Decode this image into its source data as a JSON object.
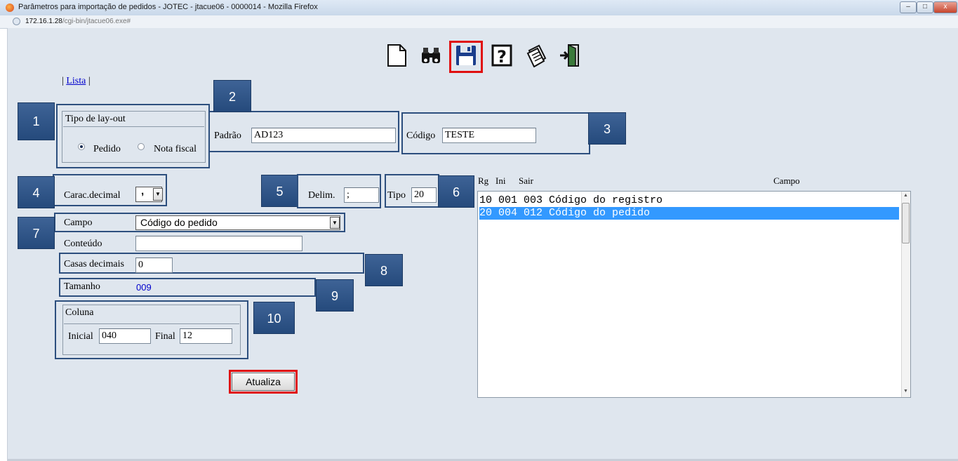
{
  "window": {
    "title": "Parâmetros para importação de pedidos - JOTEC - jtacue06 - 0000014 - Mozilla Firefox",
    "minimize": "–",
    "maximize": "□",
    "close": "x"
  },
  "address": {
    "host": "172.16.1.28",
    "path": "/cgi-bin/jtacue06.exe#"
  },
  "toolbar": {
    "icons": [
      "new-document-icon",
      "search-binoculars-icon",
      "save-disk-icon",
      "help-icon",
      "notepad-icon",
      "exit-door-icon"
    ]
  },
  "nav": {
    "sep_left": "|",
    "lista_link": "Lista",
    "sep_right": "|"
  },
  "layout_type": {
    "legend": "Tipo de lay-out",
    "option_pedido": "Pedido",
    "option_nota": "Nota fiscal",
    "selected": "Pedido"
  },
  "padrao": {
    "label": "Padrão",
    "value": "AD123"
  },
  "codigo": {
    "label": "Código",
    "value": "TESTE"
  },
  "carac_decimal": {
    "label": "Carac.decimal",
    "value": ","
  },
  "delim": {
    "label": "Delim.",
    "value": ";"
  },
  "tipo": {
    "label": "Tipo",
    "value": "20"
  },
  "campo": {
    "label": "Campo",
    "value": "Código do pedido"
  },
  "conteudo": {
    "label": "Conteúdo",
    "value": ""
  },
  "casas_decimais": {
    "label": "Casas decimais",
    "value": "0"
  },
  "tamanho": {
    "label": "Tamanho",
    "value": "009"
  },
  "coluna": {
    "legend": "Coluna",
    "inicial_label": "Inicial",
    "inicial_value": "040",
    "final_label": "Final",
    "final_value": "12"
  },
  "atualiza_button": "Atualiza",
  "list": {
    "headers": {
      "rg": "Rg",
      "ini": "Ini",
      "sair": "Sair",
      "campo": "Campo"
    },
    "rows": [
      "10 001 003 Código do registro",
      "20 004 012 Código do pedido"
    ],
    "selected_index": 1
  },
  "callouts": [
    "1",
    "2",
    "3",
    "4",
    "5",
    "6",
    "7",
    "8",
    "9",
    "10"
  ],
  "colors": {
    "callout_bg": "#2f5587",
    "highlight": "#e01010",
    "selection": "#3399ff",
    "link": "#0000cc",
    "tamanho_value": "#0000cc"
  }
}
